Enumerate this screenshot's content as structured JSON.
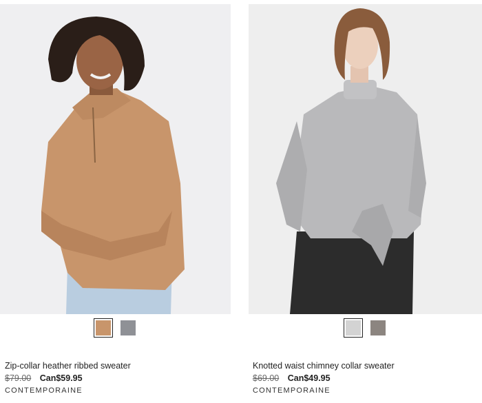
{
  "products": [
    {
      "name": "Zip-collar heather ribbed sweater",
      "old_price": "$79.00",
      "sale_price": "Can$59.95",
      "brand": "CONTEMPORAINE",
      "swatches": [
        {
          "color": "#c8956b",
          "selected": true
        },
        {
          "color": "#8f9196",
          "selected": false
        }
      ]
    },
    {
      "name": "Knotted waist chimney collar sweater",
      "old_price": "$69.00",
      "sale_price": "Can$49.95",
      "brand": "CONTEMPORAINE",
      "swatches": [
        {
          "color": "#d3d3d3",
          "selected": true
        },
        {
          "color": "#8c8580",
          "selected": false
        }
      ]
    }
  ]
}
